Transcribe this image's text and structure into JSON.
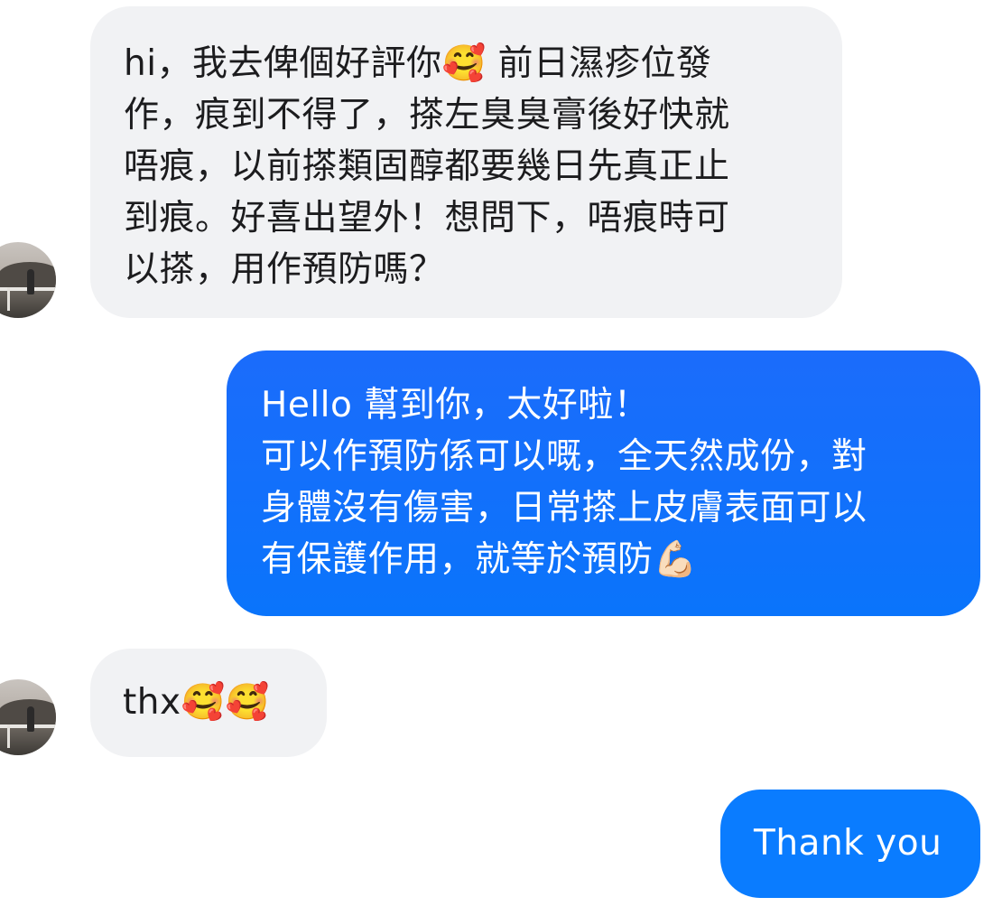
{
  "messages": [
    {
      "id": "m1",
      "direction": "incoming",
      "lines": [
        "hi，我去俾個好評你🥰 前日濕疹位發",
        "作，痕到不得了，搽左臭臭膏後好快就",
        "唔痕，以前搽類固醇都要幾日先真正止",
        "到痕。好喜出望外！想問下，唔痕時可",
        "以搽，用作預防嗎？"
      ]
    },
    {
      "id": "m2",
      "direction": "outgoing",
      "lines": [
        "Hello 幫到你，太好啦！",
        "可以作預防係可以嘅，全天然成份，對",
        "身體沒有傷害，日常搽上皮膚表面可以",
        "有保護作用，就等於預防💪🏻"
      ]
    },
    {
      "id": "m3",
      "direction": "incoming",
      "lines": [
        "thx🥰🥰"
      ]
    },
    {
      "id": "m4",
      "direction": "outgoing",
      "lines": [
        "Thank you"
      ]
    }
  ],
  "colors": {
    "incoming_bubble": "#f1f2f4",
    "outgoing_bubble": "#0a7cff",
    "incoming_text": "#1c1c1e",
    "outgoing_text": "#ffffff"
  }
}
